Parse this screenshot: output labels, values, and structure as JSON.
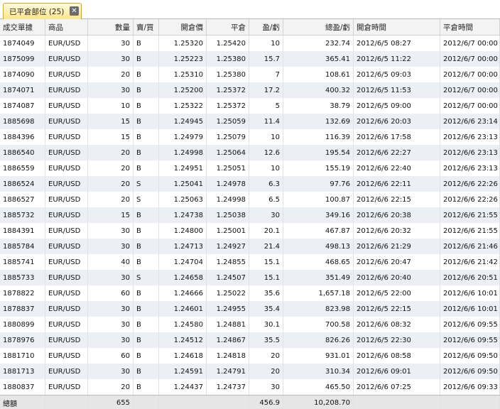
{
  "tab": {
    "label": "已平倉部位 (25)",
    "close_glyph": "✕"
  },
  "columns": [
    "成交單據",
    "商品",
    "數量",
    "賣/買",
    "開倉價",
    "平倉",
    "盈/虧",
    "總盈/虧",
    "開倉時間",
    "平倉時間"
  ],
  "rows": [
    [
      "1874049",
      "EUR/USD",
      "30",
      "B",
      "1.25320",
      "1.25420",
      "10",
      "232.74",
      "2012/6/5 08:27",
      "2012/6/7 00:00"
    ],
    [
      "1875099",
      "EUR/USD",
      "30",
      "B",
      "1.25223",
      "1.25380",
      "15.7",
      "365.41",
      "2012/6/5 11:22",
      "2012/6/7 00:00"
    ],
    [
      "1874090",
      "EUR/USD",
      "20",
      "B",
      "1.25310",
      "1.25380",
      "7",
      "108.61",
      "2012/6/5 09:03",
      "2012/6/7 00:00"
    ],
    [
      "1874071",
      "EUR/USD",
      "30",
      "B",
      "1.25200",
      "1.25372",
      "17.2",
      "400.32",
      "2012/6/5 11:53",
      "2012/6/7 00:00"
    ],
    [
      "1874087",
      "EUR/USD",
      "10",
      "B",
      "1.25322",
      "1.25372",
      "5",
      "38.79",
      "2012/6/5 09:00",
      "2012/6/7 00:00"
    ],
    [
      "1885698",
      "EUR/USD",
      "15",
      "B",
      "1.24945",
      "1.25059",
      "11.4",
      "132.69",
      "2012/6/6 20:03",
      "2012/6/6 23:14"
    ],
    [
      "1884396",
      "EUR/USD",
      "15",
      "B",
      "1.24979",
      "1.25079",
      "10",
      "116.39",
      "2012/6/6 17:58",
      "2012/6/6 23:13"
    ],
    [
      "1886540",
      "EUR/USD",
      "20",
      "B",
      "1.24998",
      "1.25064",
      "12.6",
      "195.54",
      "2012/6/6 22:27",
      "2012/6/6 23:13"
    ],
    [
      "1886559",
      "EUR/USD",
      "20",
      "B",
      "1.24951",
      "1.25051",
      "10",
      "155.19",
      "2012/6/6 22:40",
      "2012/6/6 23:13"
    ],
    [
      "1886524",
      "EUR/USD",
      "20",
      "S",
      "1.25041",
      "1.24978",
      "6.3",
      "97.76",
      "2012/6/6 22:11",
      "2012/6/6 22:26"
    ],
    [
      "1886527",
      "EUR/USD",
      "20",
      "S",
      "1.25063",
      "1.24998",
      "6.5",
      "100.87",
      "2012/6/6 22:15",
      "2012/6/6 22:26"
    ],
    [
      "1885732",
      "EUR/USD",
      "15",
      "B",
      "1.24738",
      "1.25038",
      "30",
      "349.16",
      "2012/6/6 20:38",
      "2012/6/6 21:55"
    ],
    [
      "1884391",
      "EUR/USD",
      "30",
      "B",
      "1.24800",
      "1.25001",
      "20.1",
      "467.87",
      "2012/6/6 20:32",
      "2012/6/6 21:55"
    ],
    [
      "1885784",
      "EUR/USD",
      "30",
      "B",
      "1.24713",
      "1.24927",
      "21.4",
      "498.13",
      "2012/6/6 21:29",
      "2012/6/6 21:46"
    ],
    [
      "1885741",
      "EUR/USD",
      "40",
      "B",
      "1.24704",
      "1.24855",
      "15.1",
      "468.65",
      "2012/6/6 20:47",
      "2012/6/6 21:42"
    ],
    [
      "1885733",
      "EUR/USD",
      "30",
      "S",
      "1.24658",
      "1.24507",
      "15.1",
      "351.49",
      "2012/6/6 20:40",
      "2012/6/6 20:51"
    ],
    [
      "1878822",
      "EUR/USD",
      "60",
      "B",
      "1.24666",
      "1.25022",
      "35.6",
      "1,657.18",
      "2012/6/5 22:00",
      "2012/6/6 10:01"
    ],
    [
      "1878837",
      "EUR/USD",
      "30",
      "B",
      "1.24601",
      "1.24955",
      "35.4",
      "823.98",
      "2012/6/5 22:15",
      "2012/6/6 10:01"
    ],
    [
      "1880899",
      "EUR/USD",
      "30",
      "B",
      "1.24580",
      "1.24881",
      "30.1",
      "700.58",
      "2012/6/6 08:32",
      "2012/6/6 09:55"
    ],
    [
      "1878976",
      "EUR/USD",
      "30",
      "B",
      "1.24512",
      "1.24867",
      "35.5",
      "826.26",
      "2012/6/5 22:30",
      "2012/6/6 09:55"
    ],
    [
      "1881710",
      "EUR/USD",
      "60",
      "B",
      "1.24618",
      "1.24818",
      "20",
      "931.01",
      "2012/6/6 08:58",
      "2012/6/6 09:50"
    ],
    [
      "1881713",
      "EUR/USD",
      "30",
      "B",
      "1.24591",
      "1.24791",
      "20",
      "310.34",
      "2012/6/6 09:01",
      "2012/6/6 09:50"
    ],
    [
      "1880837",
      "EUR/USD",
      "20",
      "B",
      "1.24437",
      "1.24737",
      "30",
      "465.50",
      "2012/6/6 07:25",
      "2012/6/6 09:33"
    ]
  ],
  "footer": [
    "總額",
    "",
    "655",
    "",
    "",
    "",
    "456.9",
    "10,208.70",
    "",
    ""
  ]
}
